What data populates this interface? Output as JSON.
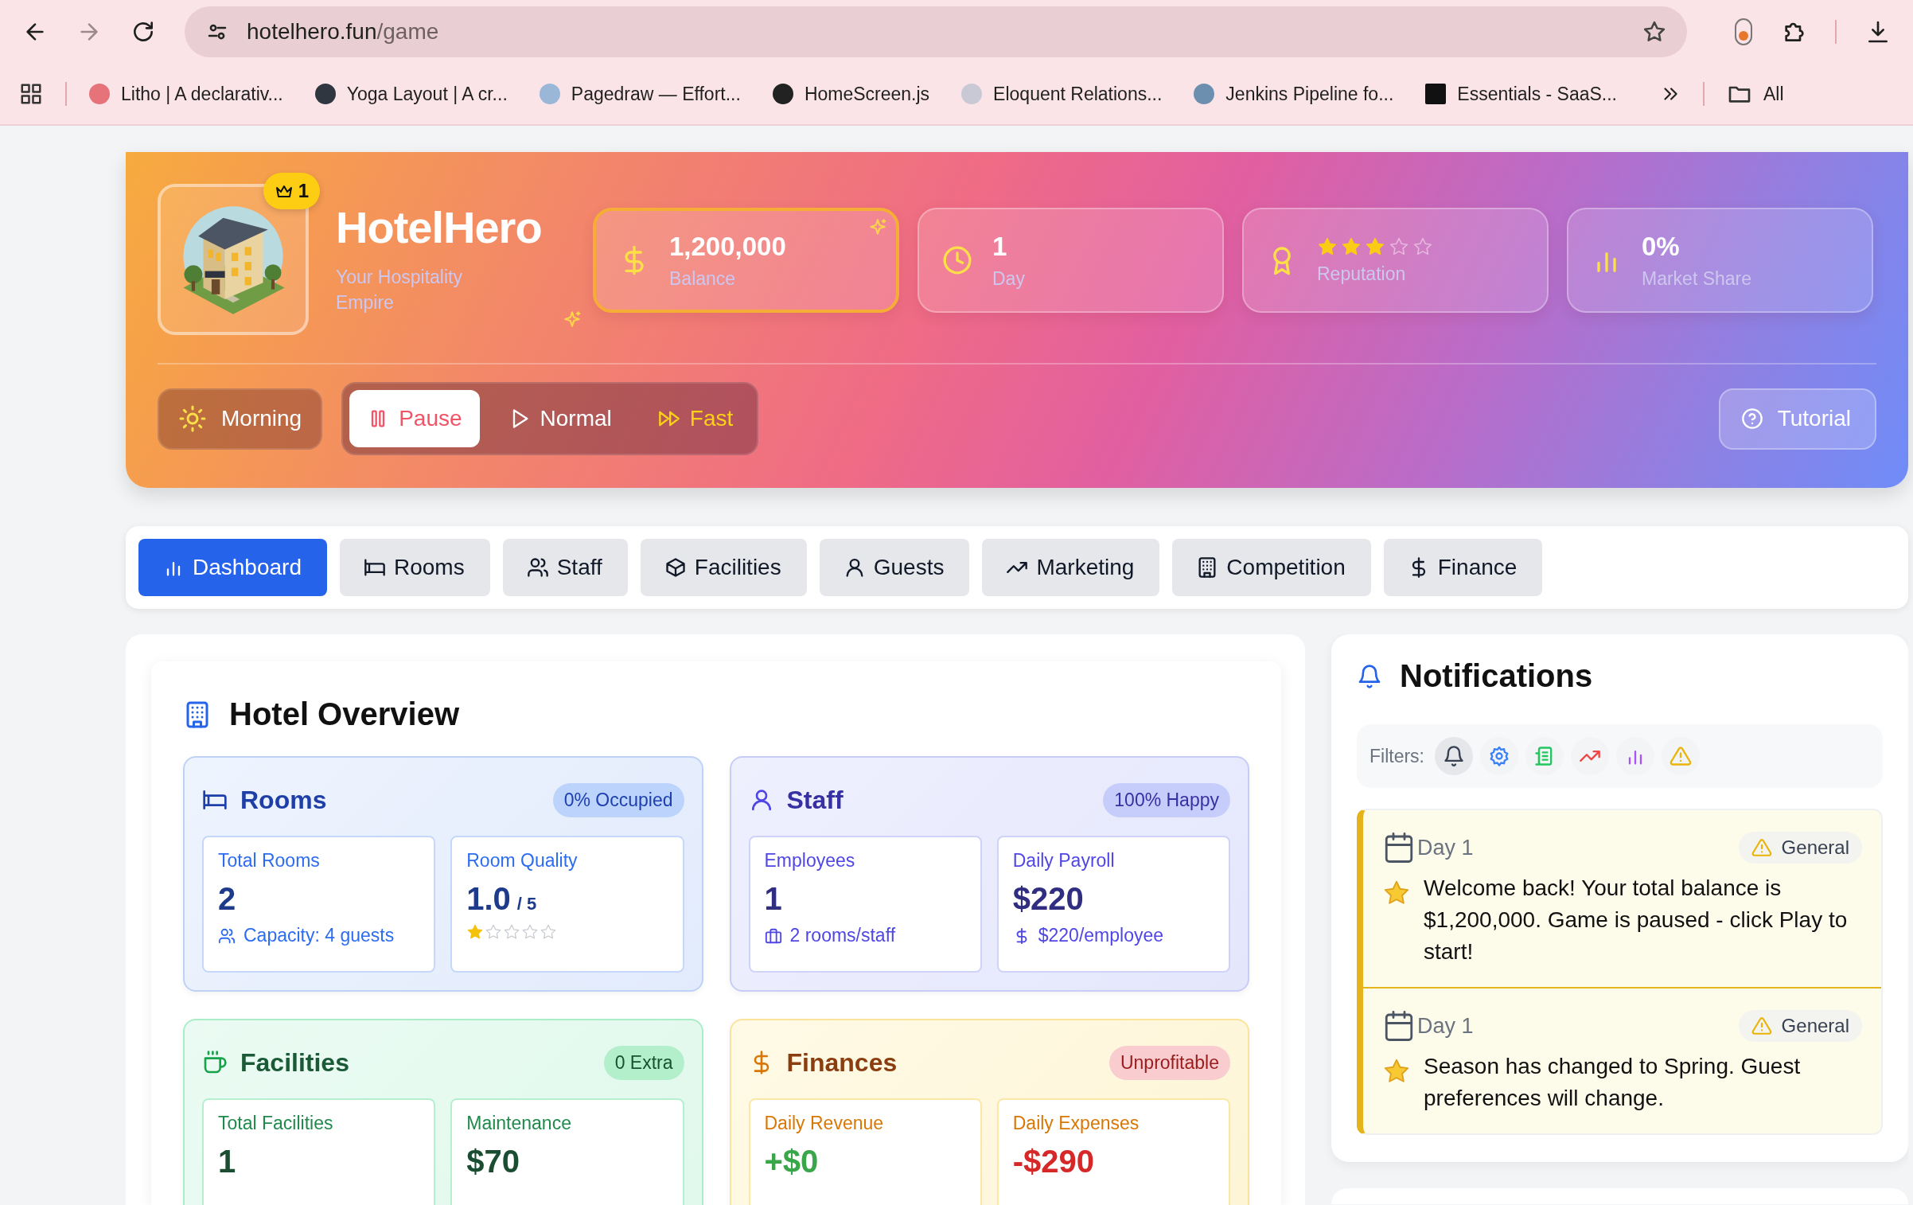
{
  "browser": {
    "url_host": "hotelhero.fun",
    "url_path": "/game",
    "bookmarks": [
      {
        "title": "Litho | A declarativ..."
      },
      {
        "title": "Yoga Layout | A cr..."
      },
      {
        "title": "Pagedraw — Effort..."
      },
      {
        "title": "HomeScreen.js"
      },
      {
        "title": "Eloquent Relations..."
      },
      {
        "title": "Jenkins Pipeline fo..."
      },
      {
        "title": "Essentials - SaaS..."
      }
    ],
    "all_bookmarks": "All"
  },
  "header": {
    "level_badge": "1",
    "title": "HotelHero",
    "subtitle": "Your Hospitality Empire",
    "stats": [
      {
        "kind": "money",
        "value": "1,200,000",
        "label": "Balance",
        "highlighted": true
      },
      {
        "kind": "day",
        "value": "1",
        "label": "Day",
        "highlighted": false
      },
      {
        "kind": "reputation",
        "stars": 3,
        "label": "Reputation",
        "highlighted": false
      },
      {
        "kind": "share",
        "value": "0%",
        "label": "Market Share",
        "highlighted": false
      }
    ],
    "time_of_day": "Morning",
    "speeds": [
      {
        "kind": "pause",
        "label": "Pause",
        "selected": true
      },
      {
        "kind": "normal",
        "label": "Normal",
        "selected": false
      },
      {
        "kind": "fast",
        "label": "Fast",
        "selected": false
      }
    ],
    "tutorial": "Tutorial"
  },
  "tabs": [
    {
      "label": "Dashboard",
      "selected": true
    },
    {
      "label": "Rooms",
      "selected": false
    },
    {
      "label": "Staff",
      "selected": false
    },
    {
      "label": "Facilities",
      "selected": false
    },
    {
      "label": "Guests",
      "selected": false
    },
    {
      "label": "Marketing",
      "selected": false
    },
    {
      "label": "Competition",
      "selected": false
    },
    {
      "label": "Finance",
      "selected": false
    }
  ],
  "overview": {
    "title": "Hotel Overview",
    "cards": [
      {
        "kind": "rooms",
        "title": "Rooms",
        "badge": "0% Occupied",
        "stats": [
          {
            "label": "Total Rooms",
            "value": "2",
            "note": "Capacity: 4 guests"
          },
          {
            "label": "Room Quality",
            "value": "1.0",
            "unit": "/ 5",
            "stars": 1
          }
        ]
      },
      {
        "kind": "staff",
        "title": "Staff",
        "badge": "100% Happy",
        "stats": [
          {
            "label": "Employees",
            "value": "1",
            "note": "2 rooms/staff"
          },
          {
            "label": "Daily Payroll",
            "value": "$220",
            "note": "$220/employee"
          }
        ]
      },
      {
        "kind": "facilities",
        "title": "Facilities",
        "badge": "0 Extra",
        "stats": [
          {
            "label": "Total Facilities",
            "value": "1"
          },
          {
            "label": "Maintenance",
            "value": "$70"
          }
        ]
      },
      {
        "kind": "finances",
        "title": "Finances",
        "badge": "Unprofitable",
        "stats": [
          {
            "label": "Daily Revenue",
            "value": "+$0",
            "color": "#3aa64a"
          },
          {
            "label": "Daily Expenses",
            "value": "-$290",
            "color": "#d62828"
          }
        ]
      }
    ]
  },
  "notifications": {
    "title": "Notifications",
    "filters_label": "Filters:",
    "filters": [
      {
        "selected": true
      },
      {
        "selected": false
      },
      {
        "selected": false
      },
      {
        "selected": false
      },
      {
        "selected": false
      },
      {
        "selected": false
      }
    ],
    "items": [
      {
        "day": "Day 1",
        "category": "General",
        "text": "Welcome back! Your total balance is $1,200,000. Game is paused - click Play to start!"
      },
      {
        "day": "Day 1",
        "category": "General",
        "text": "Season has changed to Spring. Guest preferences will change."
      }
    ]
  }
}
